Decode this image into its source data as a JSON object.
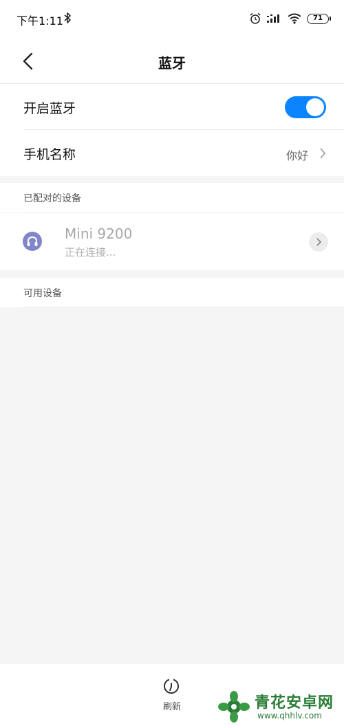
{
  "status_bar": {
    "time": "下午1:11",
    "battery": "71",
    "icons": [
      "bluetooth-icon",
      "alarm-icon",
      "signal-icon",
      "wifi-icon",
      "battery-icon"
    ]
  },
  "header": {
    "title": "蓝牙",
    "back_icon": "back-arrow-icon"
  },
  "settings": {
    "bluetooth_label": "开启蓝牙",
    "bluetooth_on": true,
    "phone_name_label": "手机名称",
    "phone_name_value": "你好"
  },
  "paired": {
    "section_label": "已配对的设备",
    "devices": [
      {
        "name": "Mini 9200",
        "status": "正在连接...",
        "icon": "headset-icon"
      }
    ]
  },
  "available": {
    "section_label": "可用设备"
  },
  "bottom": {
    "refresh_label": "刷新",
    "refresh_icon": "refresh-icon"
  },
  "watermark": {
    "name": "青花安卓网",
    "url": "www.qhhlv.com"
  },
  "colors": {
    "accent": "#0d84ff",
    "device_icon": "#8086c9",
    "watermark": "#2b7d36"
  }
}
